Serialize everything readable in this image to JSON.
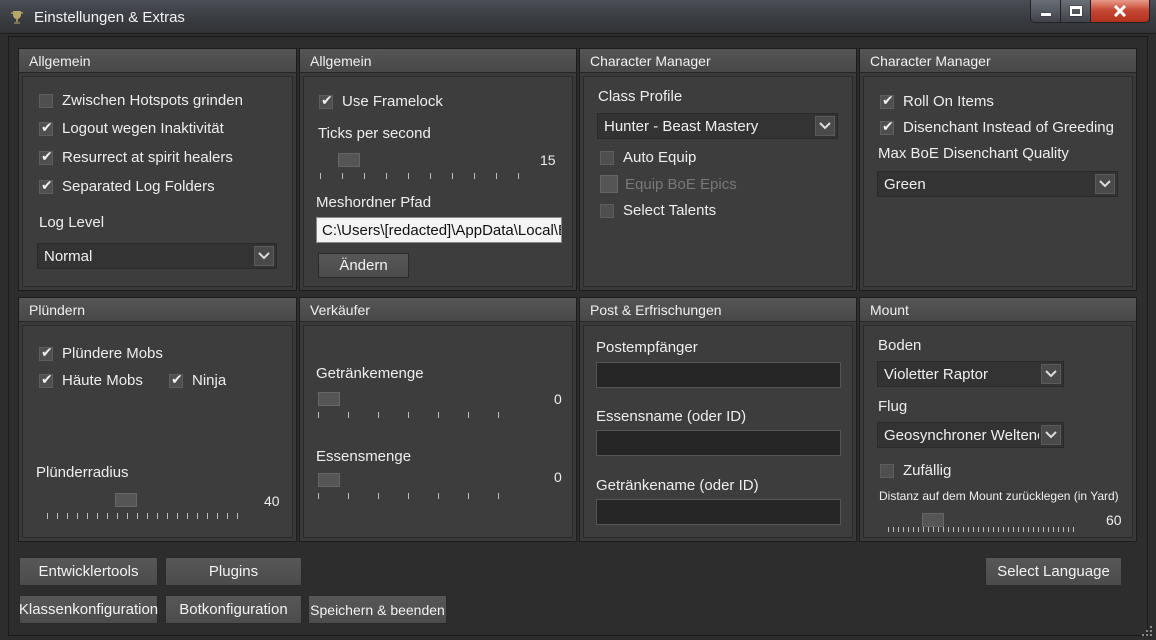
{
  "window": {
    "title": "Einstellungen & Extras"
  },
  "panels": {
    "general1": {
      "header": "Allgemein",
      "hotspots": "Zwischen Hotspots grinden",
      "logout": "Logout wegen Inaktivität",
      "resurrect": "Resurrect at spirit healers",
      "separated": "Separated Log Folders",
      "log_level_label": "Log Level",
      "log_level_value": "Normal"
    },
    "general2": {
      "header": "Allgemein",
      "framelock": "Use Framelock",
      "ticks_label": "Ticks per second",
      "ticks_value": "15",
      "ticks_fraction": 0.1,
      "mesh_label": "Meshordner Pfad",
      "mesh_path": "C:\\Users\\[redacted]\\AppData\\Local\\B",
      "change_button": "Ändern"
    },
    "charmgr1": {
      "header": "Character Manager",
      "class_profile_label": "Class Profile",
      "class_profile_value": "Hunter - Beast Mastery",
      "auto_equip": "Auto Equip",
      "equip_boe": "Equip BoE Epics",
      "select_talents": "Select Talents"
    },
    "charmgr2": {
      "header": "Character Manager",
      "roll_on_items": "Roll On Items",
      "disenchant": "Disenchant Instead of Greeding",
      "max_boe_label": "Max BoE Disenchant Quality",
      "max_boe_value": "Green"
    },
    "loot": {
      "header": "Plündern",
      "loot_mobs": "Plündere Mobs",
      "skin_mobs": "Häute Mobs",
      "ninja": "Ninja",
      "radius_label": "Plünderradius",
      "radius_value": "40",
      "radius_fraction": 0.38
    },
    "vendor": {
      "header": "Verkäufer",
      "drink_label": "Getränkemenge",
      "drink_value": "0",
      "food_label": "Essensmenge",
      "food_value": "0"
    },
    "mail": {
      "header": "Post & Erfrischungen",
      "recipient_label": "Postempfänger",
      "recipient_value": "",
      "food_name_label": "Essensname (oder ID)",
      "food_name_value": "",
      "drink_name_label": "Getränkename (oder ID)",
      "drink_name_value": ""
    },
    "mount": {
      "header": "Mount",
      "ground_label": "Boden",
      "ground_value": "Violetter Raptor",
      "flying_label": "Flug",
      "flying_value": "Geosynchroner Weltenc",
      "random": "Zufällig",
      "distance_label": "Distanz auf dem Mount zurücklegen (in Yard)",
      "distance_value": "60",
      "distance_fraction": 0.2
    }
  },
  "buttons": {
    "devtools": "Entwicklertools",
    "plugins": "Plugins",
    "class_config": "Klassenkonfiguration",
    "bot_config": "Botkonfiguration",
    "save_exit": "Speichern & beenden",
    "select_language": "Select Language"
  }
}
